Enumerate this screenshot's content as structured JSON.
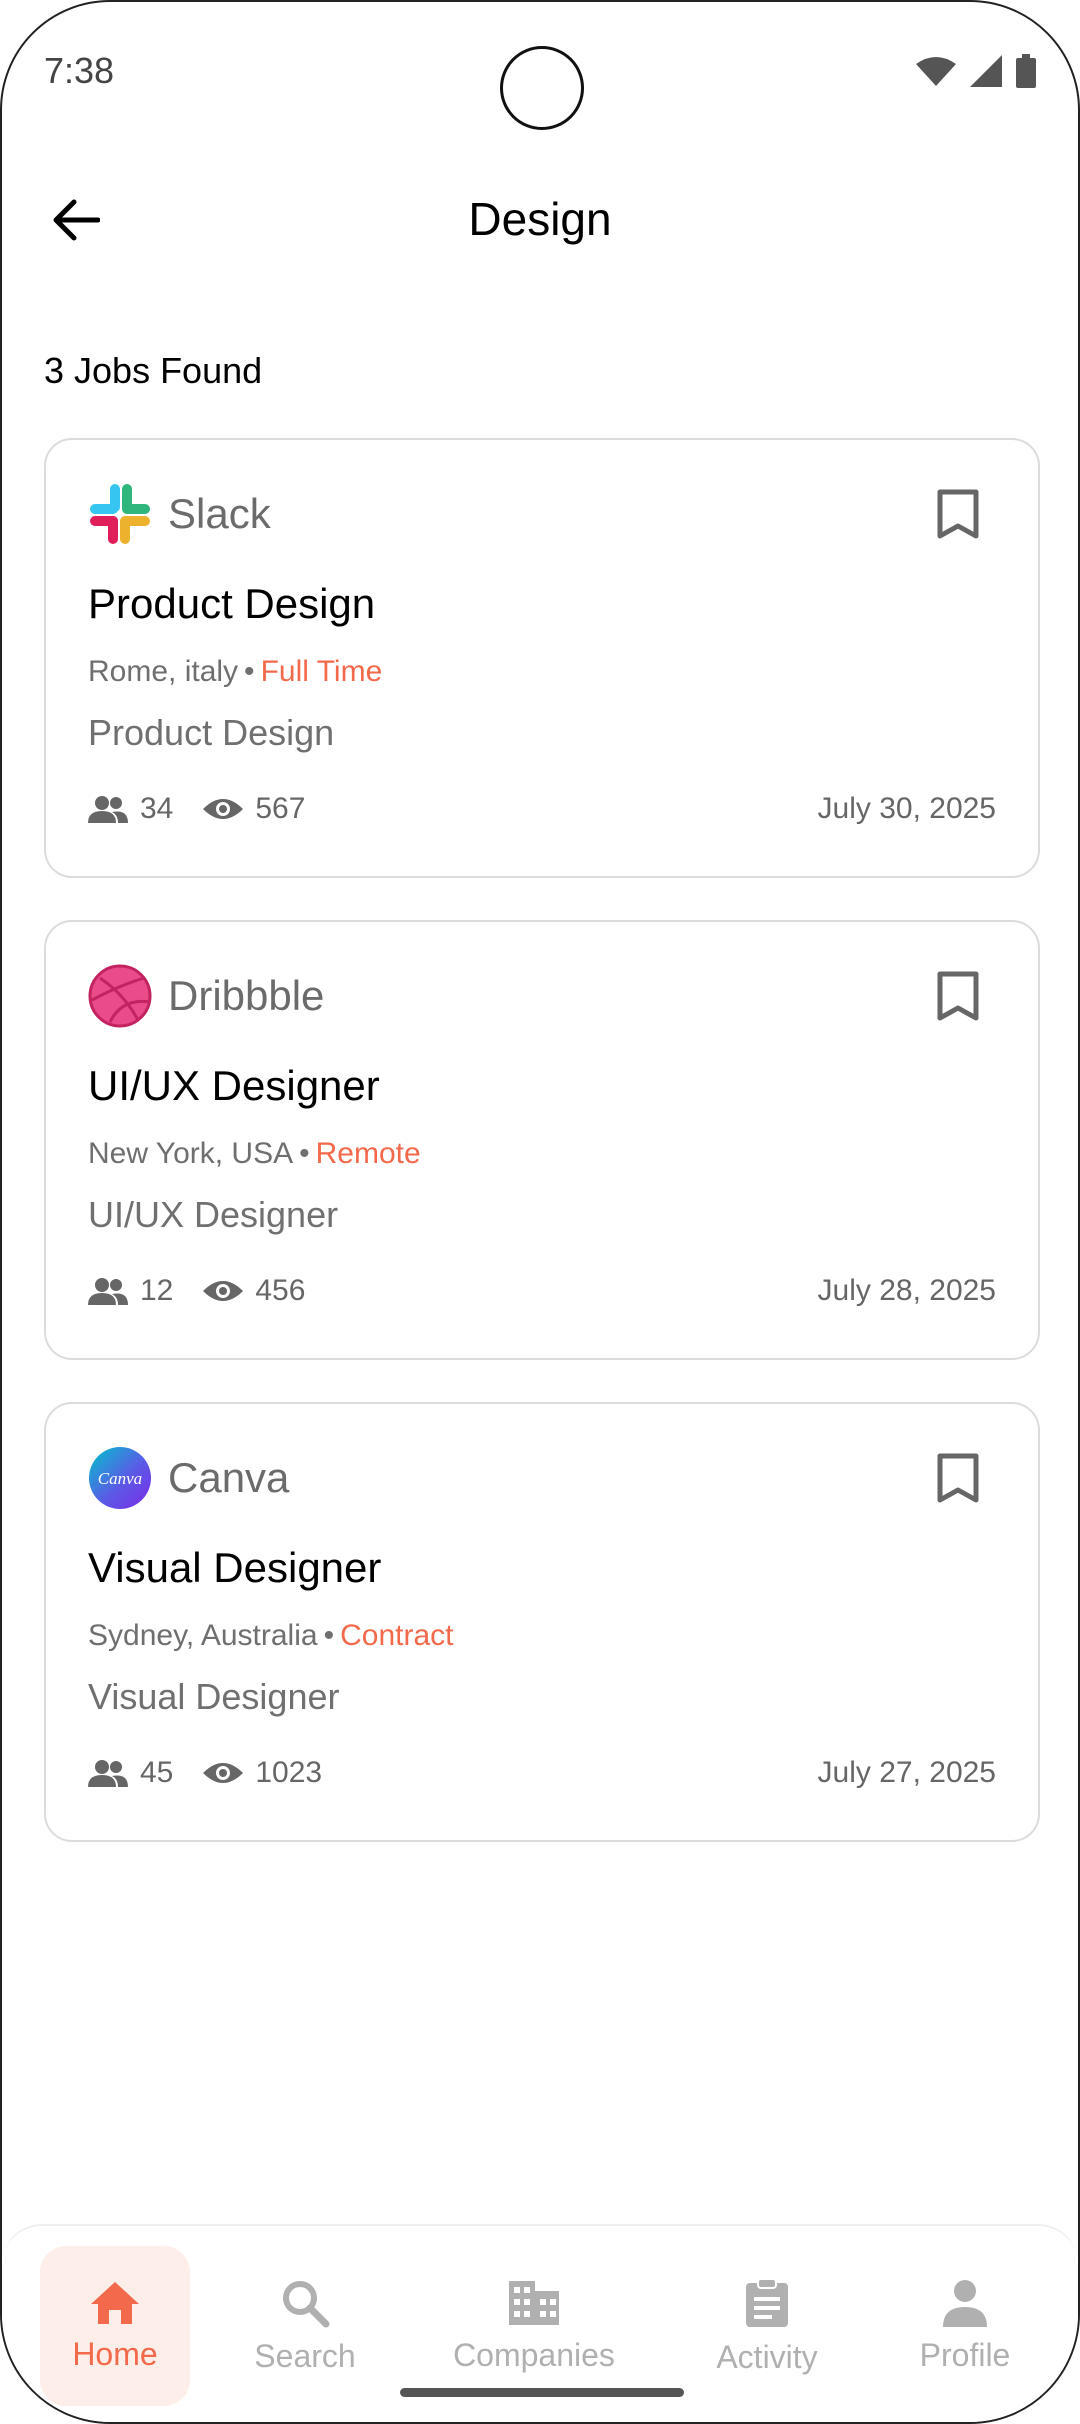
{
  "status_bar": {
    "time": "7:38"
  },
  "header": {
    "title": "Design"
  },
  "results": {
    "count_text": "3 Jobs Found"
  },
  "jobs": [
    {
      "company": "Slack",
      "logo": "slack-logo",
      "title": "Product Design",
      "location": "Rome, italy",
      "type": "Full Time",
      "subtitle": "Product Design",
      "applicants": "34",
      "views": "567",
      "date": "July 30, 2025"
    },
    {
      "company": "Dribbble",
      "logo": "dribbble-logo",
      "title": "UI/UX Designer",
      "location": "New York, USA",
      "type": "Remote",
      "subtitle": "UI/UX Designer",
      "applicants": "12",
      "views": "456",
      "date": "July 28, 2025"
    },
    {
      "company": "Canva",
      "logo": "canva-logo",
      "title": "Visual Designer",
      "location": "Sydney, Australia",
      "type": "Contract",
      "subtitle": "Visual Designer",
      "applicants": "45",
      "views": "1023",
      "date": "July 27, 2025"
    }
  ],
  "canva_logo_text": "Canva",
  "bottom_nav": {
    "items": [
      {
        "label": "Home",
        "icon": "home-icon",
        "active": true
      },
      {
        "label": "Search",
        "icon": "search-icon",
        "active": false
      },
      {
        "label": "Companies",
        "icon": "building-icon",
        "active": false
      },
      {
        "label": "Activity",
        "icon": "clipboard-icon",
        "active": false
      },
      {
        "label": "Profile",
        "icon": "person-icon",
        "active": false
      }
    ]
  },
  "colors": {
    "accent": "#f26a4b",
    "accent_bg": "#fdeee9",
    "muted": "#b0b0b0"
  }
}
